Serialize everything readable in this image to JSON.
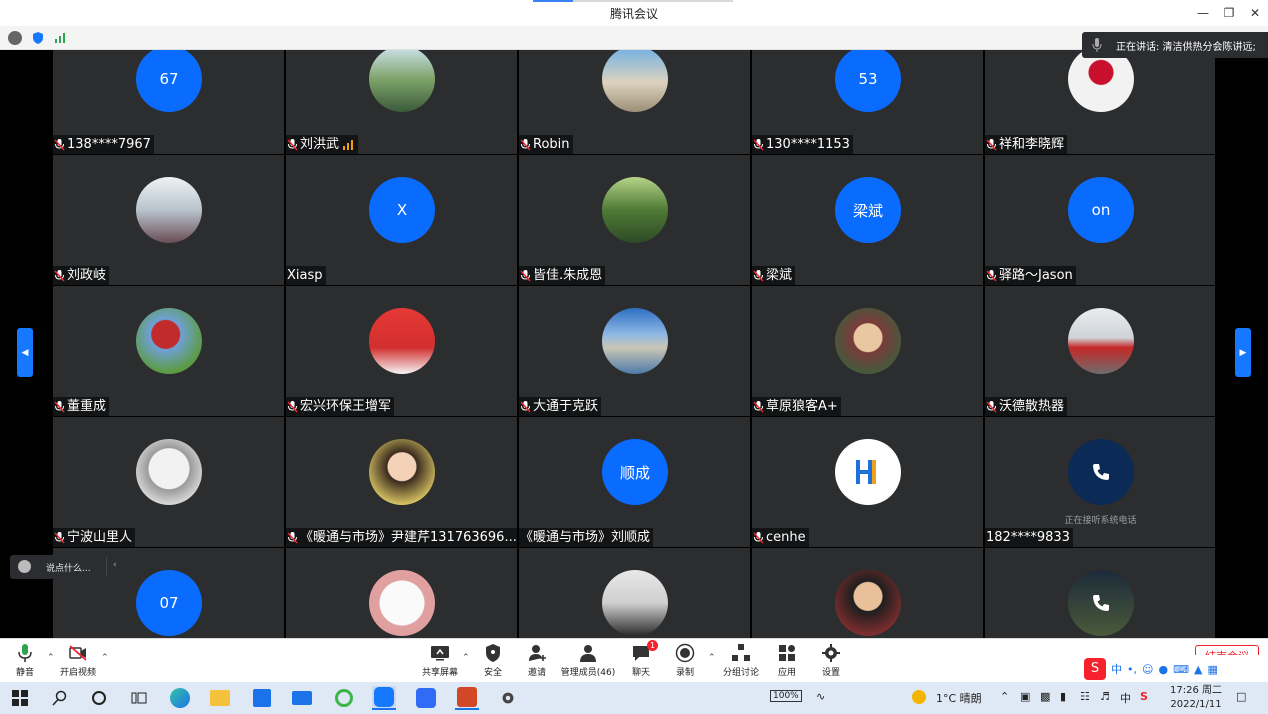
{
  "window": {
    "title": "腾讯会议"
  },
  "speaker": {
    "text": "正在讲话: 清洁供热分会陈讲远;"
  },
  "colors": {
    "accent": "#0a6cff",
    "tile_bg": "#2c2d2f",
    "end_red": "#f5222d"
  },
  "participants": [
    {
      "name": "138****7967",
      "avatar_text": "67",
      "avatar_kind": "text",
      "muted": true
    },
    {
      "name": "刘洪武",
      "avatar_text": "",
      "avatar_kind": "photo-landscape",
      "muted": true,
      "signal": true
    },
    {
      "name": "Robin",
      "avatar_text": "",
      "avatar_kind": "photo-cathedral",
      "muted": true
    },
    {
      "name": "130****1153",
      "avatar_text": "53",
      "avatar_kind": "text",
      "muted": true
    },
    {
      "name": "祥和李晓辉",
      "avatar_text": "",
      "avatar_kind": "logo-xianghe",
      "muted": true
    },
    {
      "name": "刘政岐",
      "avatar_text": "",
      "avatar_kind": "photo-snow",
      "muted": true
    },
    {
      "name": "Xiasp",
      "avatar_text": "X",
      "avatar_kind": "text",
      "muted": false
    },
    {
      "name": "皆佳.朱成恩",
      "avatar_text": "",
      "avatar_kind": "photo-forest",
      "muted": true
    },
    {
      "name": "梁斌",
      "avatar_text": "梁斌",
      "avatar_kind": "text",
      "muted": true
    },
    {
      "name": "驿路～Jason",
      "avatar_text": "on",
      "avatar_kind": "text",
      "muted": true
    },
    {
      "name": "董重成",
      "avatar_text": "",
      "avatar_kind": "photo-sculpture",
      "muted": true
    },
    {
      "name": "宏兴环保王增军",
      "avatar_text": "",
      "avatar_kind": "photo-red-poster",
      "muted": true
    },
    {
      "name": "大通于克跃",
      "avatar_text": "",
      "avatar_kind": "photo-lake",
      "muted": true
    },
    {
      "name": "草原狼客A+",
      "avatar_text": "",
      "avatar_kind": "photo-child",
      "muted": true
    },
    {
      "name": "沃德散热器",
      "avatar_text": "",
      "avatar_kind": "photo-cars",
      "muted": true
    },
    {
      "name": "宁波山里人",
      "avatar_text": "",
      "avatar_kind": "photo-sketch",
      "muted": true
    },
    {
      "name": "《暖通与市场》尹建芹131763696...",
      "avatar_text": "",
      "avatar_kind": "photo-woman",
      "muted": true
    },
    {
      "name": "《暖通与市场》刘顺成",
      "avatar_text": "顺成",
      "avatar_kind": "text",
      "muted": false
    },
    {
      "name": "cenhe",
      "avatar_text": "",
      "avatar_kind": "logo-chenhe",
      "muted": true
    },
    {
      "name": "182****9833",
      "avatar_text": "",
      "avatar_kind": "phone",
      "muted": false,
      "sub": "正在接听系统电话"
    },
    {
      "name": "",
      "avatar_text": "07",
      "avatar_kind": "text",
      "muted": false
    },
    {
      "name": "",
      "avatar_text": "",
      "avatar_kind": "photo-calligraphy",
      "muted": false
    },
    {
      "name": "",
      "avatar_text": "",
      "avatar_kind": "photo-man",
      "muted": false
    },
    {
      "name": "",
      "avatar_text": "",
      "avatar_kind": "photo-boy",
      "muted": false
    },
    {
      "name": "",
      "avatar_text": "",
      "avatar_kind": "phone-dark",
      "muted": false
    }
  ],
  "chat_input": {
    "placeholder": "说点什么..."
  },
  "toolbar": {
    "mute": "静音",
    "video": "开启视频",
    "share": "共享屏幕",
    "security": "安全",
    "invite": "邀请",
    "members": "管理成员(46)",
    "chat": "聊天",
    "chat_badge": "1",
    "record": "录制",
    "breakout": "分组讨论",
    "apps": "应用",
    "settings": "设置",
    "end": "结束会议"
  },
  "ime": {
    "lang": "中"
  },
  "tray": {
    "battery": "100%",
    "weather": "1°C 晴朗",
    "input_lang": "中"
  },
  "clock": {
    "time": "17:26 周二",
    "date": "2022/1/11"
  }
}
